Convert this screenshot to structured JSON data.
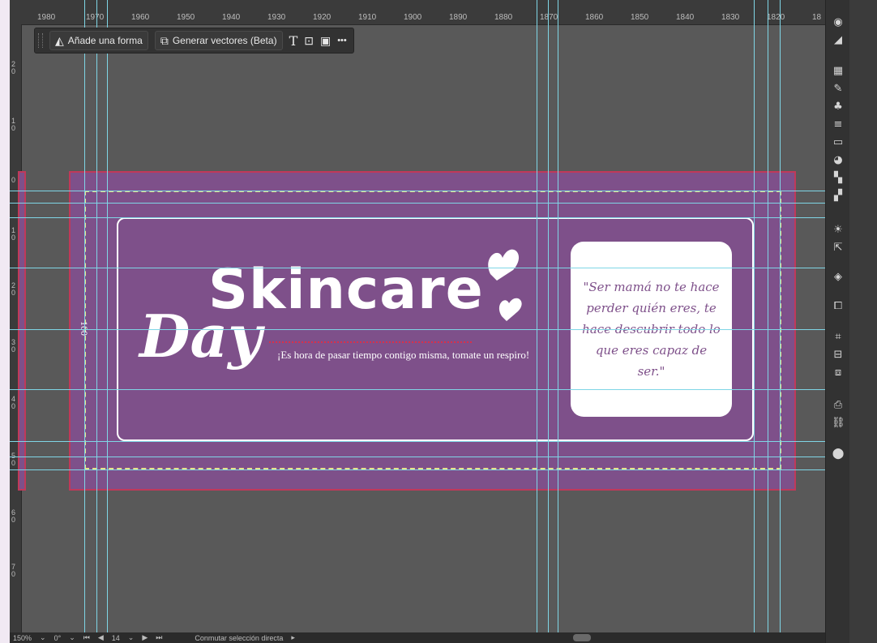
{
  "ruler": {
    "top": [
      "1980",
      "1970",
      "1960",
      "1950",
      "1940",
      "1930",
      "1920",
      "1910",
      "1900",
      "1890",
      "1880",
      "1870",
      "1860",
      "1850",
      "1840",
      "1830",
      "1820",
      "18"
    ],
    "left": [
      "2 0",
      "1 0",
      "0",
      "1 0",
      "2 0",
      "3 0",
      "4 0",
      "5 0",
      "6 0",
      "7 0"
    ]
  },
  "toolbar": {
    "shape_label": "Añade una forma",
    "vectors_label": "Generar vectores (Beta)",
    "text_tool": "T",
    "more": "•••"
  },
  "artboard": {
    "title": "Skincare",
    "script": "Day",
    "subtitle": "¡Es hora de pasar tiempo contigo misma, tomate un respiro!",
    "vertical_number": "100",
    "quote": "\"Ser mamá no te hace perder quién eres, te hace descubrir todo lo que eres capaz de ser.\""
  },
  "status": {
    "zoom": "150%",
    "angle": "0°",
    "page": "14",
    "mode": "Conmutar selección directa"
  },
  "colors": {
    "artboard_bg": "#7e508a",
    "guide": "#7fd6e6",
    "dash": "#e6e48a",
    "bleed": "#c0395a"
  }
}
